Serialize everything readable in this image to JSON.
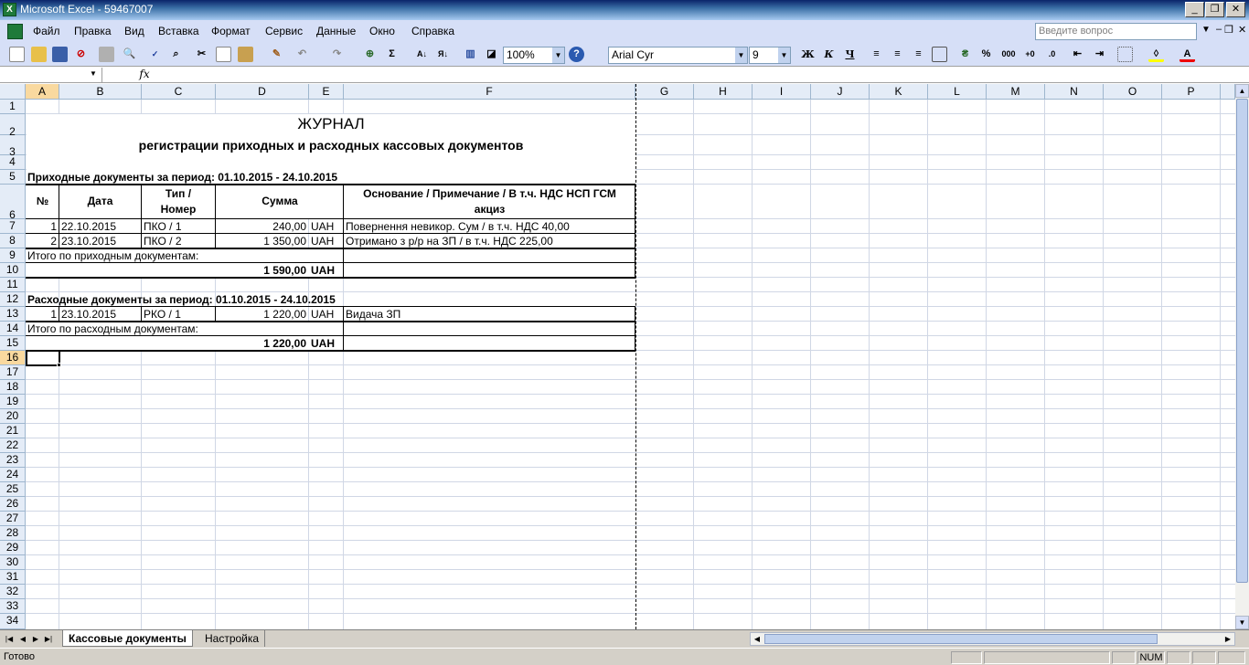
{
  "window": {
    "title": "Microsoft Excel - 59467007"
  },
  "menu": [
    "Файл",
    "Правка",
    "Вид",
    "Вставка",
    "Формат",
    "Сервис",
    "Данные",
    "Окно",
    "Справка"
  ],
  "ask_placeholder": "Введите вопрос",
  "toolbar": {
    "zoom": "100%",
    "font": "Arial Cyr",
    "size": "9",
    "bold": "Ж",
    "italic": "К",
    "underline": "Ч",
    "sum": "Σ",
    "percent": "%",
    "thousands": "000"
  },
  "formula": {
    "name_box": "",
    "fx": "fx",
    "content": ""
  },
  "columns": [
    "A",
    "B",
    "C",
    "D",
    "E",
    "F",
    "G",
    "H",
    "I",
    "J",
    "K",
    "L",
    "M",
    "N",
    "O",
    "P"
  ],
  "rows": [
    "1",
    "2",
    "3",
    "4",
    "5",
    "6",
    "7",
    "8",
    "9",
    "10",
    "11",
    "12",
    "13",
    "14",
    "15",
    "16",
    "17",
    "18",
    "19",
    "20",
    "21",
    "22",
    "23",
    "24",
    "25",
    "26",
    "27",
    "28",
    "29",
    "30",
    "31",
    "32",
    "33",
    "34"
  ],
  "selected_cell": "A16",
  "sheet": {
    "title": "ЖУРНАЛ",
    "subtitle": "регистрации приходных и расходных кассовых документов",
    "income_period": "Приходные документы за период:  01.10.2015 - 24.10.2015",
    "headers": {
      "num": "№",
      "date": "Дата",
      "type1": "Тип /",
      "type2": "Номер",
      "sum": "Сумма",
      "basis1": "Основание / Примечание / В т.ч. НДС НСП ГСМ",
      "basis2": "акциз"
    },
    "income_rows": [
      {
        "n": "1",
        "date": "22.10.2015",
        "type": "ПКО / 1",
        "sum": "240,00",
        "cur": "UAH",
        "basis": "Повернення невикор. Сум / в т.ч. НДС 40,00"
      },
      {
        "n": "2",
        "date": "23.10.2015",
        "type": "ПКО / 2",
        "sum": "1 350,00",
        "cur": "UAH",
        "basis": "Отримано з р/р на ЗП / в т.ч. НДС 225,00"
      }
    ],
    "income_total_label": "Итого по приходным  документам:",
    "income_total": "1 590,00",
    "income_total_cur": "UAH",
    "expense_period": "Расходные документы за период:  01.10.2015 - 24.10.2015",
    "expense_rows": [
      {
        "n": "1",
        "date": "23.10.2015",
        "type": "РКО / 1",
        "sum": "1 220,00",
        "cur": "UAH",
        "basis": "Видача ЗП"
      }
    ],
    "expense_total_label": "Итого по расходным  документам:",
    "expense_total": "1 220,00",
    "expense_total_cur": "UAH"
  },
  "tabs": [
    "Кассовые документы",
    "Настройка"
  ],
  "status": {
    "text": "Готово",
    "num": "NUM"
  }
}
